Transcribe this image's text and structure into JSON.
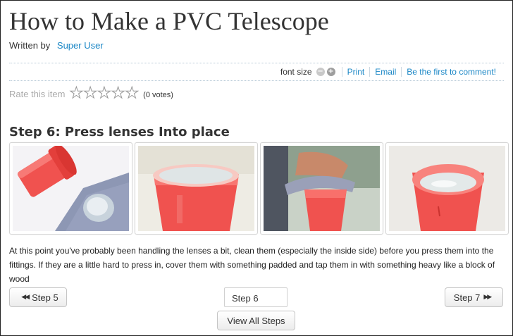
{
  "article": {
    "title": "How to Make a PVC Telescope",
    "written_by_label": "Written by",
    "author": "Super User"
  },
  "toolbar": {
    "font_size_label": "font size",
    "decrease_symbol": "−",
    "increase_symbol": "+",
    "print": "Print",
    "email": "Email",
    "comment": "Be the first to comment!"
  },
  "rating": {
    "label": "Rate this item",
    "star_count": 5,
    "votes": "(0 votes)"
  },
  "step": {
    "title": "Step 6: Press lenses Into place",
    "description": "At this point you've probably been handling the lenses a bit, clean them (especially the inside side) before you press them into the fittings. If they are a little hard to press in, cover them with something padded and tap them in with something heavy like a block of wood",
    "images": [
      {
        "name": "photo-fitting-and-lens-on-cloth"
      },
      {
        "name": "photo-lens-in-fitting-closeup"
      },
      {
        "name": "photo-pressing-lens-with-cloth"
      },
      {
        "name": "photo-lens-seated-in-fitting"
      }
    ]
  },
  "nav": {
    "prev_label": "Step 5",
    "current_label": "Step 6",
    "next_label": "Step 7",
    "view_all_label": "View All Steps"
  },
  "colors": {
    "link": "#1b87c6",
    "pvc_red": "#f0524f"
  }
}
